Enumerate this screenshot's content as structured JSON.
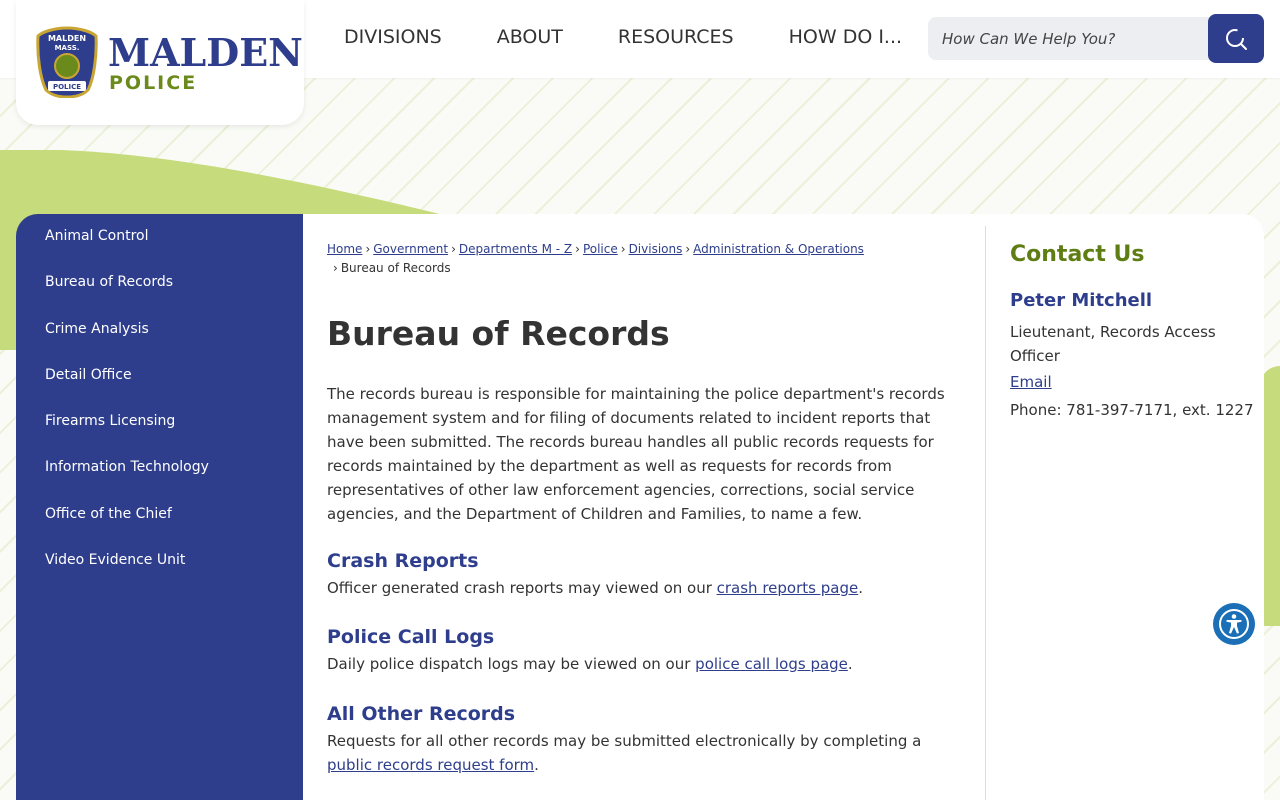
{
  "logo": {
    "word": "MALDEN",
    "sub": "POLICE",
    "badge_top": "MALDEN",
    "badge_mid": "MASS.",
    "badge_bottom": "POLICE"
  },
  "nav": {
    "items": [
      "DIVISIONS",
      "ABOUT",
      "RESOURCES",
      "HOW DO I..."
    ]
  },
  "search": {
    "placeholder": "How Can We Help You?",
    "icon": "search-icon"
  },
  "sidebar": {
    "items": [
      {
        "label": "Animal Control"
      },
      {
        "label": "Bureau of Records"
      },
      {
        "label": "Crime Analysis"
      },
      {
        "label": "Detail Office"
      },
      {
        "label": "Firearms Licensing"
      },
      {
        "label": "Information Technology"
      },
      {
        "label": "Office of the Chief"
      },
      {
        "label": "Video Evidence Unit"
      }
    ]
  },
  "breadcrumb": {
    "links": [
      "Home",
      "Government",
      "Departments M - Z",
      "Police",
      "Divisions",
      "Administration & Operations"
    ],
    "separator": "›",
    "current": "Bureau of Records"
  },
  "main": {
    "title": "Bureau of Records",
    "intro": "The records bureau is responsible for maintaining the police department's records management system and for filing of documents related to incident reports that have been submitted. The records bureau handles all public records requests for records maintained by the department as well as requests for records from representatives of other law enforcement agencies, corrections, social service agencies, and the Department of Children and Families, to name a few.",
    "sections": [
      {
        "heading": "Crash Reports",
        "text": "Officer generated crash reports may viewed on our ",
        "link": "crash reports page",
        "after": "."
      },
      {
        "heading": "Police Call Logs",
        "text": "Daily police dispatch logs may be viewed on our ",
        "link": "police call logs page",
        "after": "."
      },
      {
        "heading": "All Other Records",
        "text": "Requests for all other records may be submitted electronically by completing a ",
        "link": "public records request form",
        "after": "."
      }
    ]
  },
  "contact": {
    "title": "Contact Us",
    "name": "Peter Mitchell",
    "role": "Lieutenant, Records Access Officer",
    "email_label": "Email",
    "phone": "Phone: 781-397-7171, ext. 1227"
  },
  "colors": {
    "brand_blue": "#2e3e8c",
    "accent_green": "#5e7d12",
    "wave_green": "#c6dc7c",
    "a11y_blue": "#1a6fb7"
  }
}
